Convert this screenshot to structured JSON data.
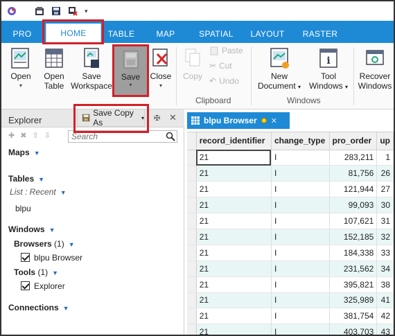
{
  "qat": {
    "icons": [
      "app-logo-icon",
      "new-project-icon",
      "save-project-icon",
      "discard-icon",
      "customize-qat-icon"
    ]
  },
  "tabs": [
    {
      "label": "PRO"
    },
    {
      "label": "HOME"
    },
    {
      "label": "TABLE"
    },
    {
      "label": "MAP"
    },
    {
      "label": "SPATIAL"
    },
    {
      "label": "LAYOUT"
    },
    {
      "label": "RASTER"
    }
  ],
  "ribbon": {
    "open": "Open",
    "open_table_1": "Open",
    "open_table_2": "Table",
    "save_workspace_1": "Save",
    "save_workspace_2": "Workspace",
    "save": "Save",
    "close": "Close",
    "copy": "Copy",
    "paste": "Paste",
    "cut": "Cut",
    "undo": "Undo",
    "clipboard_group": "Clipboard",
    "new_document_1": "New",
    "new_document_2": "Document",
    "tool_windows_1": "Tool",
    "tool_windows_2": "Windows",
    "windows_group": "Windows",
    "recover_windows_1": "Recover",
    "recover_windows_2": "Windows"
  },
  "save_copy_as": "Save Copy As",
  "explorer": {
    "title": "Explorer",
    "search_placeholder": "Search",
    "maps": "Maps",
    "tables": "Tables",
    "list_recent": "List : Recent",
    "table_item": "blpu",
    "windows": "Windows",
    "browsers": "Browsers",
    "browsers_count": "(1)",
    "browser_item": "blpu Browser",
    "tools": "Tools",
    "tools_count": "(1)",
    "tool_item": "Explorer",
    "connections": "Connections"
  },
  "browser": {
    "tab_title": "blpu Browser",
    "columns": [
      "record_identifier",
      "change_type",
      "pro_order",
      "up"
    ],
    "rows": [
      [
        "21",
        "I",
        "283,211",
        "1"
      ],
      [
        "21",
        "I",
        "81,756",
        "26"
      ],
      [
        "21",
        "I",
        "121,944",
        "27"
      ],
      [
        "21",
        "I",
        "99,093",
        "30"
      ],
      [
        "21",
        "I",
        "107,621",
        "31"
      ],
      [
        "21",
        "I",
        "152,185",
        "32"
      ],
      [
        "21",
        "I",
        "184,338",
        "33"
      ],
      [
        "21",
        "I",
        "231,562",
        "34"
      ],
      [
        "21",
        "I",
        "395,821",
        "38"
      ],
      [
        "21",
        "I",
        "325,989",
        "41"
      ],
      [
        "21",
        "I",
        "381,754",
        "42"
      ],
      [
        "21",
        "I",
        "403,703",
        "43"
      ]
    ]
  },
  "colors": {
    "accent_blue": "#1e8ad6",
    "highlight_red": "#d2202a",
    "alt_row": "#e9f6f6"
  }
}
